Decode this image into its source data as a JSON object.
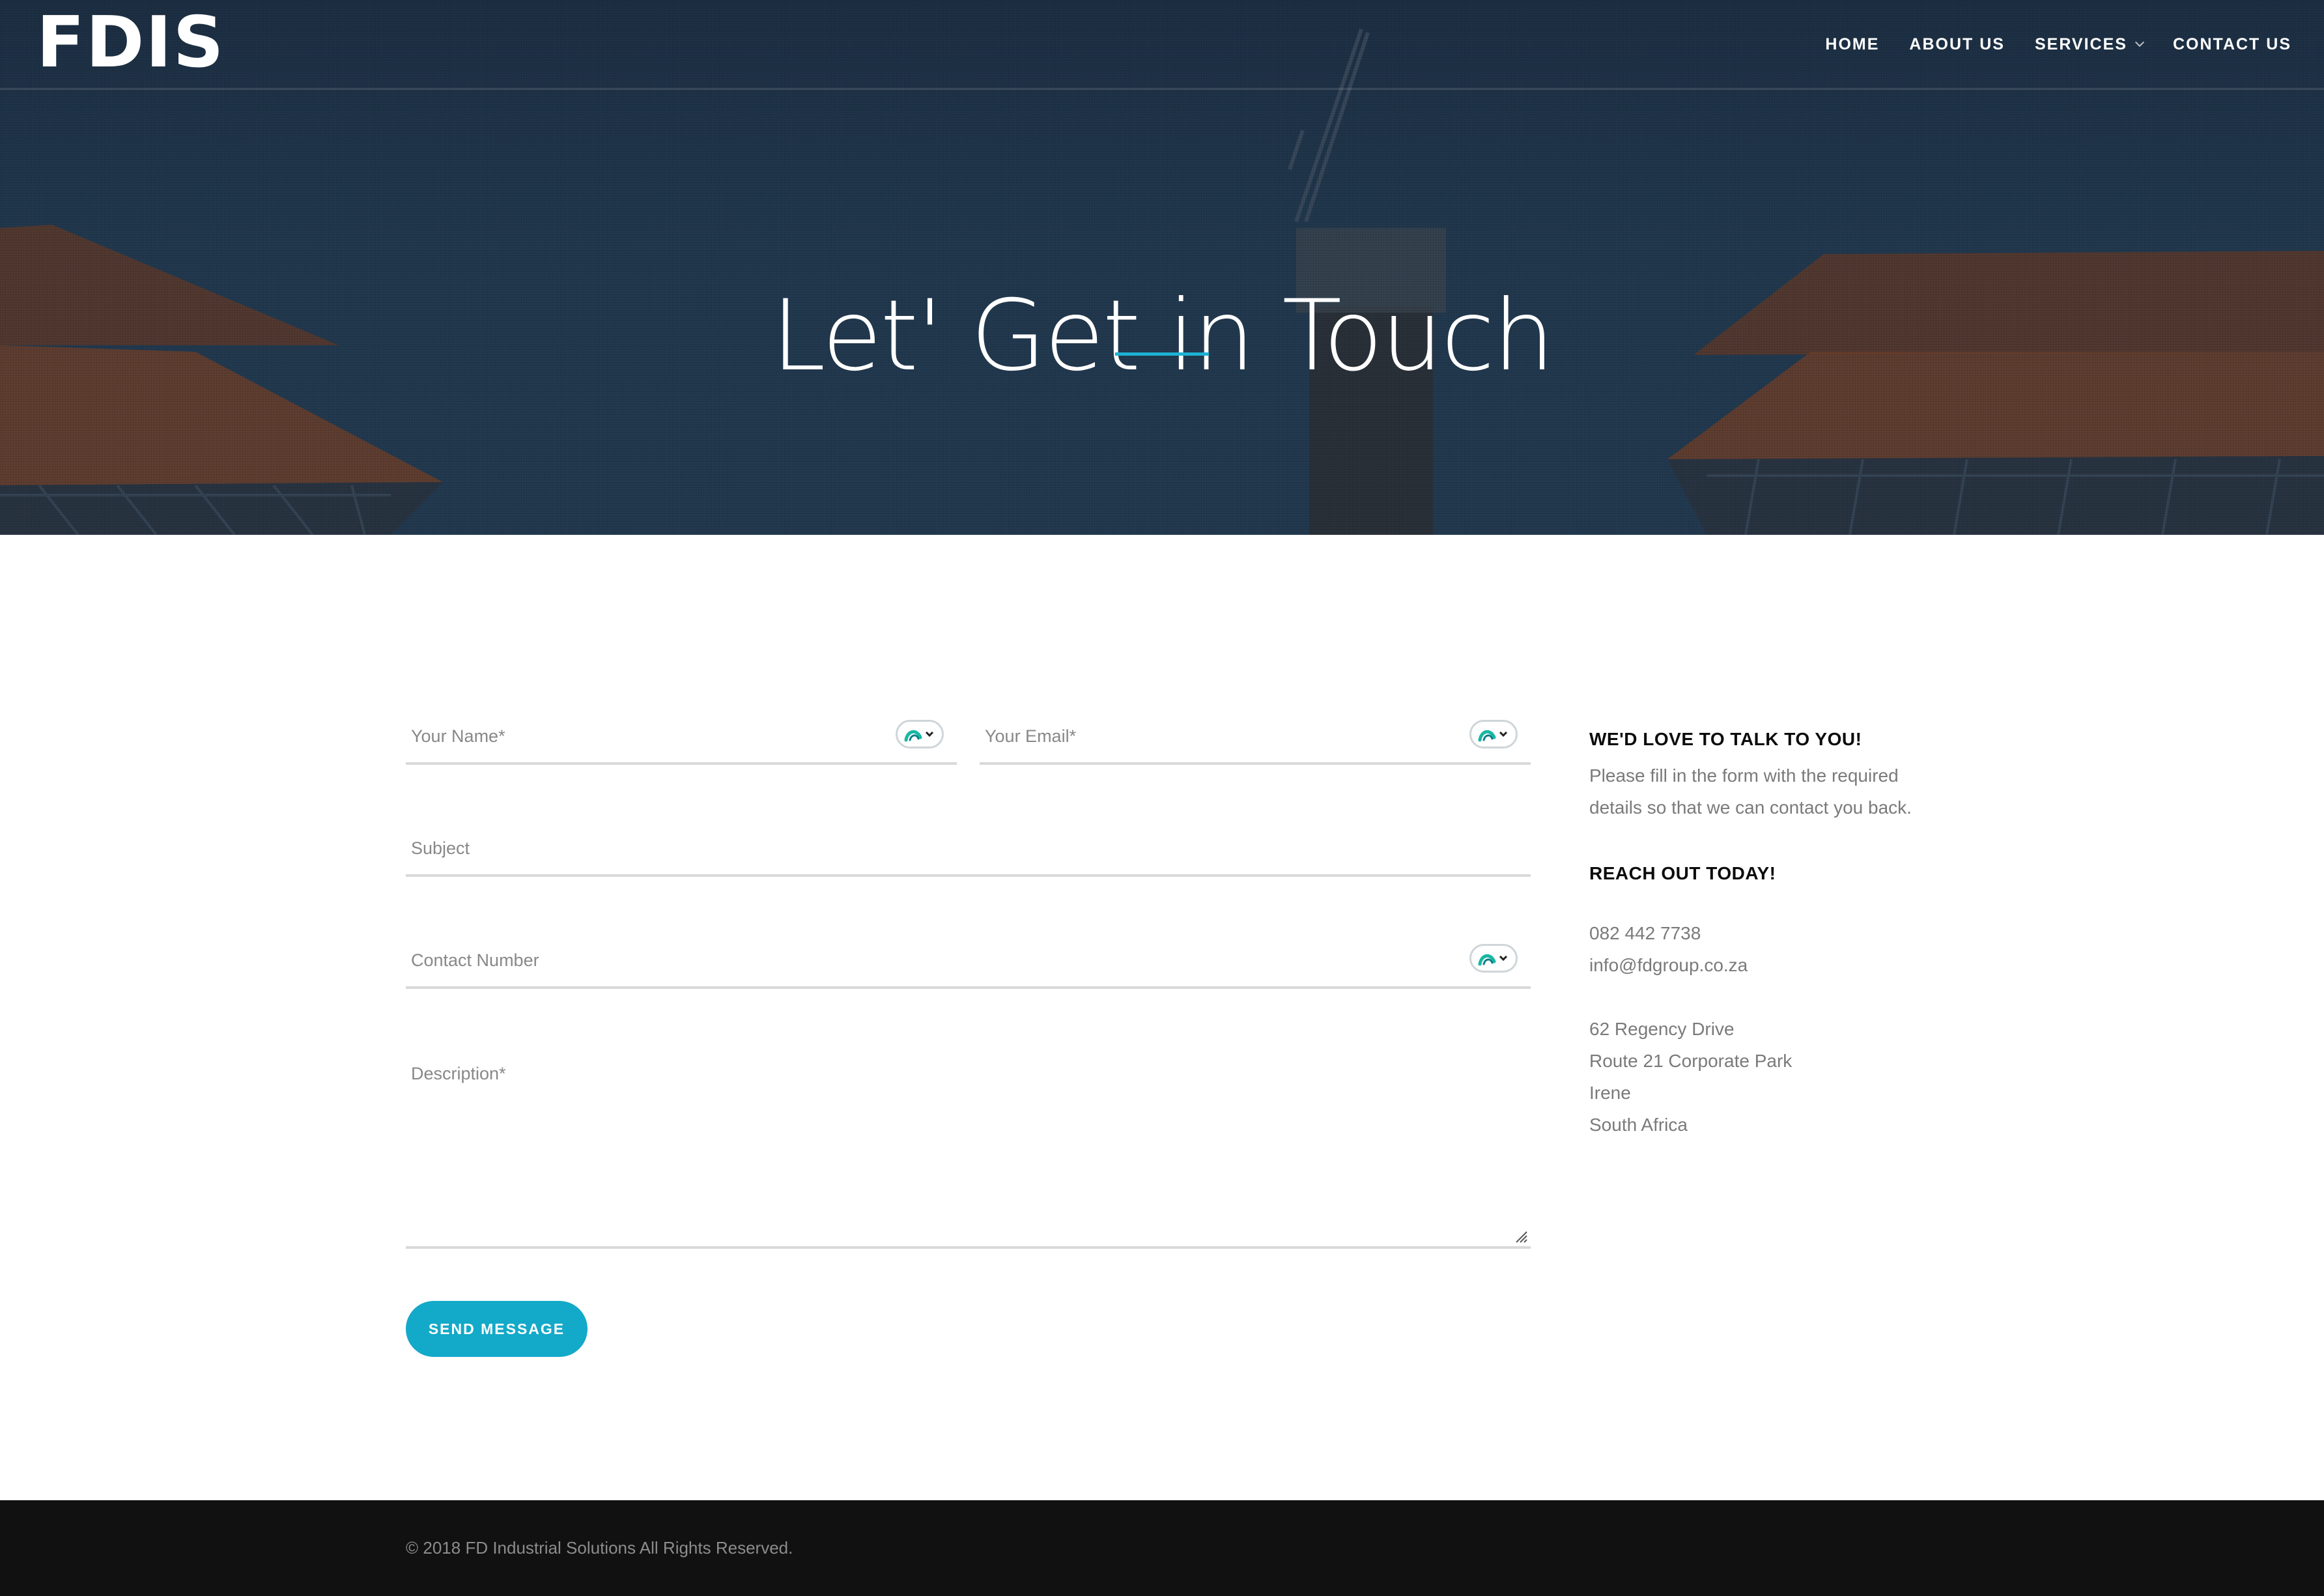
{
  "header": {
    "logo": "FDIS",
    "nav": [
      {
        "label": "HOME"
      },
      {
        "label": "ABOUT US"
      },
      {
        "label": "SERVICES"
      },
      {
        "label": "CONTACT US"
      }
    ]
  },
  "hero": {
    "title": "Let' Get in Touch",
    "accent_color": "#1eb1d3"
  },
  "form": {
    "name_placeholder": "Your Name*",
    "email_placeholder": "Your Email*",
    "subject_placeholder": "Subject",
    "contact_placeholder": "Contact Number",
    "description_placeholder": "Description*",
    "submit_label": "SEND MESSAGE",
    "button_color": "#13a9c9"
  },
  "sidebar": {
    "heading1": "WE'D LOVE TO TALK TO YOU!",
    "intro_line1": "Please fill in the form with the required",
    "intro_line2": "details so that we can contact you back.",
    "heading2": "REACH OUT TODAY!",
    "phone": "082 442 7738",
    "email": "info@fdgroup.co.za",
    "address": [
      "62 Regency Drive",
      "Route 21 Corporate Park",
      "Irene",
      "South Africa"
    ]
  },
  "footer": {
    "copyright": "© 2018 FD Industrial Solutions All Rights Reserved."
  },
  "icons": {
    "field_extension": "password-manager-icon",
    "resize": "resize-grip-icon"
  }
}
